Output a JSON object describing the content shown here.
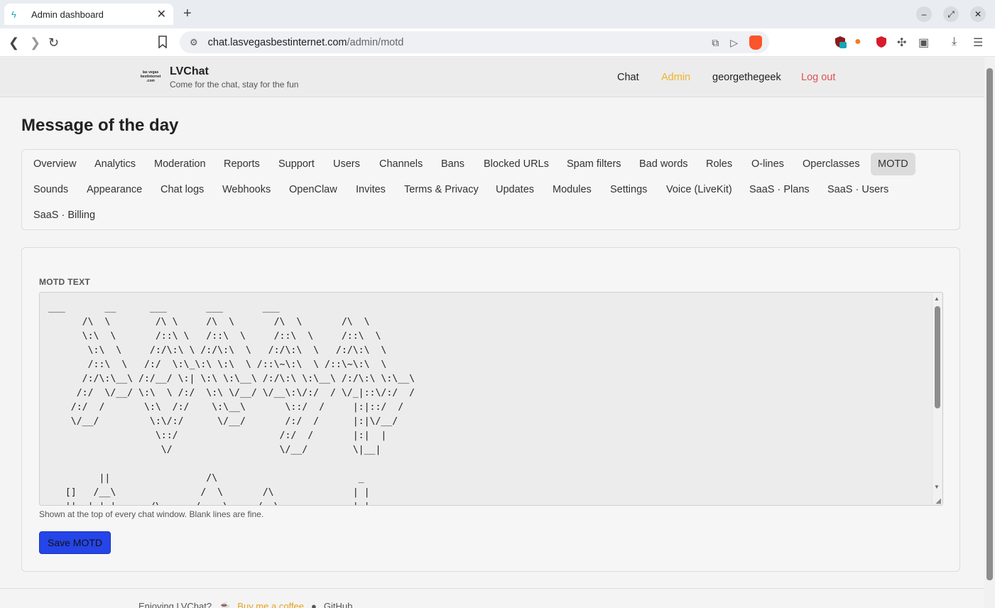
{
  "browser": {
    "tab_title": "Admin dashboard",
    "tab_close": "✕",
    "new_tab": "+",
    "url_domain": "chat.lasvegasbestinternet.com",
    "url_path": "/admin/motd",
    "extension_badge": "1"
  },
  "header": {
    "logo_text": "las vegas bestinternet .com",
    "brand_name": "LVChat",
    "tagline": "Come for the chat, stay for the fun",
    "nav": {
      "chat": "Chat",
      "admin": "Admin",
      "user": "georgethegeek",
      "logout": "Log out"
    },
    "colors": {
      "admin_active": "#f0b429",
      "logout": "#e05252"
    }
  },
  "page": {
    "title": "Message of the day"
  },
  "admin_tabs": [
    "Overview",
    "Analytics",
    "Moderation",
    "Reports",
    "Support",
    "Users",
    "Channels",
    "Bans",
    "Blocked URLs",
    "Spam filters",
    "Bad words",
    "Roles",
    "O-lines",
    "Operclasses",
    "MOTD",
    "Sounds",
    "Appearance",
    "Chat logs",
    "Webhooks",
    "OpenClaw",
    "Invites",
    "Terms & Privacy",
    "Updates",
    "Modules",
    "Settings",
    "Voice (LiveKit)",
    "SaaS · Plans",
    "SaaS · Users",
    "SaaS · Billing"
  ],
  "active_tab": "MOTD",
  "motd": {
    "label": "MOTD TEXT",
    "text": "___       __      ___       ___       ___\n      /\\  \\        /\\ \\     /\\  \\       /\\  \\       /\\  \\\n      \\:\\  \\       /::\\ \\   /::\\  \\     /::\\  \\     /::\\  \\\n       \\:\\  \\     /:/\\:\\ \\ /:/\\:\\  \\   /:/\\:\\  \\   /:/\\:\\  \\\n       /::\\  \\   /:/  \\:\\_\\:\\ \\:\\  \\ /::\\~\\:\\  \\ /::\\~\\:\\  \\\n      /:/\\:\\__\\ /:/__/ \\:| \\:\\ \\:\\__\\ /:/\\:\\ \\:\\__\\ /:/\\:\\ \\:\\__\\\n     /:/  \\/__/ \\:\\  \\ /:/  \\:\\ \\/__/ \\/__\\:\\/:/  / \\/_|::\\/:/  /\n    /:/  /       \\:\\  /:/    \\:\\__\\       \\::/  /     |:|::/  /\n    \\/__/         \\:\\/:/      \\/__/       /:/  /      |:|\\/__/\n                   \\::/                  /:/  /       |:|  |\n                    \\/                   \\/__/        \\|__|\n\n         ||                 /\\                         _\n   []   /__\\               /  \\       /\\              | |\n   ||  | | |      /\\      /    \\     /  \\             | |",
    "hint": "Shown at the top of every chat window. Blank lines are fine.",
    "save_label": "Save MOTD"
  },
  "footer": {
    "enjoying": "Enjoying LVChat?",
    "coffee": "Buy me a coffee",
    "github": "GitHub"
  },
  "icons": {
    "favicon": "bolt-icon",
    "back": "arrow-left-icon",
    "forward": "arrow-right-icon",
    "reload": "reload-icon",
    "bookmark": "bookmark-icon",
    "site_settings": "tune-icon",
    "share": "share-icon",
    "send": "send-icon"
  }
}
